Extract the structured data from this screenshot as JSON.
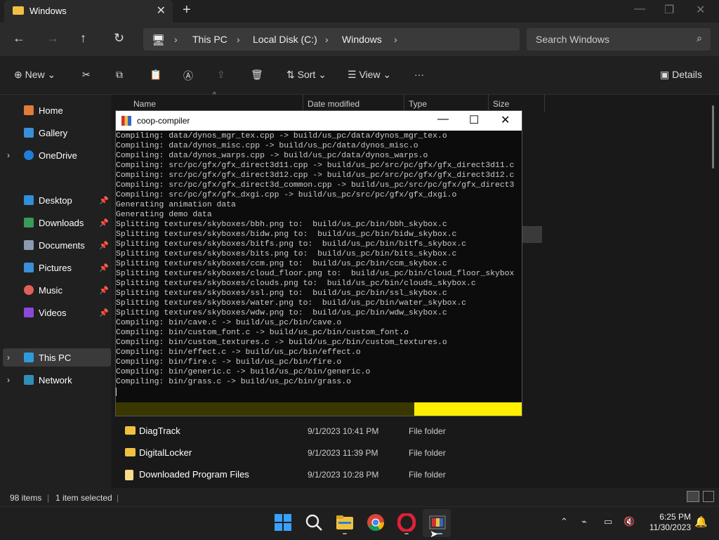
{
  "explorer": {
    "tab_title": "Windows",
    "breadcrumb": [
      "This PC",
      "Local Disk (C:)",
      "Windows"
    ],
    "search_placeholder": "Search Windows",
    "toolbar": {
      "new_label": "New",
      "sort_label": "Sort",
      "view_label": "View",
      "more_label": "···",
      "details_label": "Details"
    },
    "sidebar": {
      "home": "Home",
      "gallery": "Gallery",
      "onedrive": "OneDrive",
      "desktop": "Desktop",
      "downloads": "Downloads",
      "documents": "Documents",
      "pictures": "Pictures",
      "music": "Music",
      "videos": "Videos",
      "thispc": "This PC",
      "network": "Network"
    },
    "columns": [
      "Name",
      "Date modified",
      "Type",
      "Size"
    ],
    "files": [
      {
        "name": "DiagTrack",
        "date": "9/1/2023 10:41 PM",
        "type": "File folder"
      },
      {
        "name": "DigitalLocker",
        "date": "9/1/2023 11:39 PM",
        "type": "File folder"
      },
      {
        "name": "Downloaded Program Files",
        "date": "9/1/2023 10:28 PM",
        "type": "File folder"
      }
    ],
    "status": {
      "items": "98 items",
      "selected": "1 item selected"
    }
  },
  "console": {
    "title": "coop-compiler",
    "lines": [
      "Compiling: data/dynos_mgr_tex.cpp -> build/us_pc/data/dynos_mgr_tex.o",
      "Compiling: data/dynos_misc.cpp -> build/us_pc/data/dynos_misc.o",
      "Compiling: data/dynos_warps.cpp -> build/us_pc/data/dynos_warps.o",
      "Compiling: src/pc/gfx/gfx_direct3d11.cpp -> build/us_pc/src/pc/gfx/gfx_direct3d11.c",
      "Compiling: src/pc/gfx/gfx_direct3d12.cpp -> build/us_pc/src/pc/gfx/gfx_direct3d12.c",
      "Compiling: src/pc/gfx/gfx_direct3d_common.cpp -> build/us_pc/src/pc/gfx/gfx_direct3",
      "Compiling: src/pc/gfx/gfx_dxgi.cpp -> build/us_pc/src/pc/gfx/gfx_dxgi.o",
      "Generating animation data",
      "Generating demo data",
      "Splitting textures/skyboxes/bbh.png to:  build/us_pc/bin/bbh_skybox.c",
      "Splitting textures/skyboxes/bidw.png to:  build/us_pc/bin/bidw_skybox.c",
      "Splitting textures/skyboxes/bitfs.png to:  build/us_pc/bin/bitfs_skybox.c",
      "Splitting textures/skyboxes/bits.png to:  build/us_pc/bin/bits_skybox.c",
      "Splitting textures/skyboxes/ccm.png to:  build/us_pc/bin/ccm_skybox.c",
      "Splitting textures/skyboxes/cloud_floor.png to:  build/us_pc/bin/cloud_floor_skybox",
      "Splitting textures/skyboxes/clouds.png to:  build/us_pc/bin/clouds_skybox.c",
      "Splitting textures/skyboxes/ssl.png to:  build/us_pc/bin/ssl_skybox.c",
      "Splitting textures/skyboxes/water.png to:  build/us_pc/bin/water_skybox.c",
      "Splitting textures/skyboxes/wdw.png to:  build/us_pc/bin/wdw_skybox.c",
      "Compiling: bin/cave.c -> build/us_pc/bin/cave.o",
      "Compiling: bin/custom_font.c -> build/us_pc/bin/custom_font.o",
      "Compiling: bin/custom_textures.c -> build/us_pc/bin/custom_textures.o",
      "Compiling: bin/effect.c -> build/us_pc/bin/effect.o",
      "Compiling: bin/fire.c -> build/us_pc/bin/fire.o",
      "Compiling: bin/generic.c -> build/us_pc/bin/generic.o",
      "Compiling: bin/grass.c -> build/us_pc/bin/grass.o"
    ],
    "progress": 0.735,
    "colors": {
      "progress_done": "#3a3700",
      "progress_remaining": "#ffef00"
    }
  },
  "taskbar": {
    "apps": [
      "start-icon",
      "search-icon",
      "file-explorer-icon",
      "chrome-icon",
      "opera-icon",
      "coop-compiler-icon"
    ],
    "time": "6:25 PM",
    "date": "11/30/2023"
  }
}
